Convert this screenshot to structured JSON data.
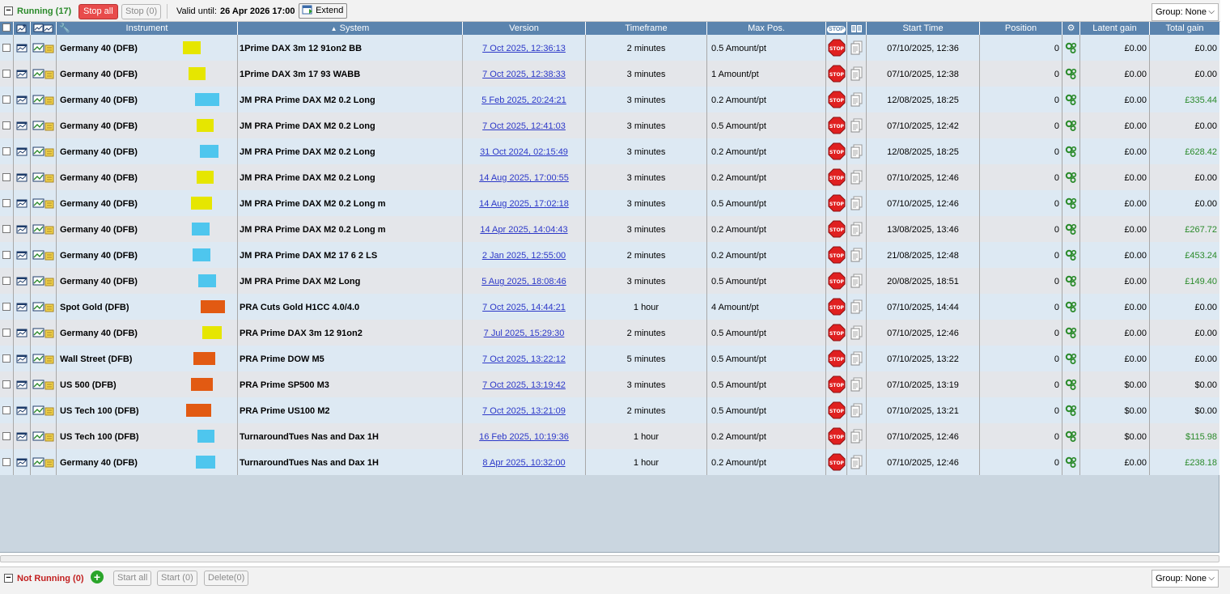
{
  "running": {
    "title": "Running (17)",
    "stop_all": "Stop all",
    "stop_btn": "Stop (0)",
    "valid_until_label": "Valid until:",
    "valid_until": "26 Apr 2026 17:00",
    "extend": "Extend",
    "group": "Group: None"
  },
  "columns": {
    "instrument": "Instrument",
    "system": "System",
    "version": "Version",
    "timeframe": "Timeframe",
    "max_pos": "Max Pos.",
    "stop_badge": "STOP",
    "start_time": "Start Time",
    "position": "Position",
    "latent_gain": "Latent gain",
    "total_gain": "Total gain"
  },
  "colors": {
    "yellow": "#e6e600",
    "cyan": "#4ec6ee",
    "orange": "#e25a12",
    "header": "#5b84ae",
    "gain_positive": "#2a8a2a",
    "link": "#2c38c8"
  },
  "rows": [
    {
      "instrument": "Germany 40 (DFB)",
      "tag": "yellow",
      "system": "1Prime DAX 3m 12 91on2 BB",
      "version": "7 Oct 2025, 12:36:13",
      "timeframe": "2 minutes",
      "maxpos": "0.5 Amount/pt",
      "start": "07/10/2025, 12:36",
      "position": "0",
      "latent": "£0.00",
      "total": "£0.00",
      "pos": false
    },
    {
      "instrument": "Germany 40 (DFB)",
      "tag": "yellow",
      "system": "1Prime DAX 3m 17 93 WABB",
      "version": "7 Oct 2025, 12:38:33",
      "timeframe": "3 minutes",
      "maxpos": "1 Amount/pt",
      "start": "07/10/2025, 12:38",
      "position": "0",
      "latent": "£0.00",
      "total": "£0.00",
      "pos": false
    },
    {
      "instrument": "Germany 40 (DFB)",
      "tag": "cyan",
      "system": "JM PRA Prime DAX M2 0.2 Long",
      "version": "5 Feb 2025, 20:24:21",
      "timeframe": "3 minutes",
      "maxpos": "0.2 Amount/pt",
      "start": "12/08/2025, 18:25",
      "position": "0",
      "latent": "£0.00",
      "total": "£335.44",
      "pos": true
    },
    {
      "instrument": "Germany 40 (DFB)",
      "tag": "yellow",
      "system": "JM PRA Prime DAX M2 0.2 Long",
      "version": "7 Oct 2025, 12:41:03",
      "timeframe": "3 minutes",
      "maxpos": "0.5 Amount/pt",
      "start": "07/10/2025, 12:42",
      "position": "0",
      "latent": "£0.00",
      "total": "£0.00",
      "pos": false
    },
    {
      "instrument": "Germany 40 (DFB)",
      "tag": "cyan",
      "system": "JM PRA Prime DAX M2 0.2 Long",
      "version": "31 Oct 2024, 02:15:49",
      "timeframe": "3 minutes",
      "maxpos": "0.2 Amount/pt",
      "start": "12/08/2025, 18:25",
      "position": "0",
      "latent": "£0.00",
      "total": "£628.42",
      "pos": true
    },
    {
      "instrument": "Germany 40 (DFB)",
      "tag": "yellow",
      "system": "JM PRA Prime DAX M2 0.2 Long",
      "version": "14 Aug 2025, 17:00:55",
      "timeframe": "3 minutes",
      "maxpos": "0.2 Amount/pt",
      "start": "07/10/2025, 12:46",
      "position": "0",
      "latent": "£0.00",
      "total": "£0.00",
      "pos": false
    },
    {
      "instrument": "Germany 40 (DFB)",
      "tag": "yellow",
      "system": "JM PRA Prime DAX M2 0.2 Long m",
      "version": "14 Aug 2025, 17:02:18",
      "timeframe": "3 minutes",
      "maxpos": "0.5 Amount/pt",
      "start": "07/10/2025, 12:46",
      "position": "0",
      "latent": "£0.00",
      "total": "£0.00",
      "pos": false
    },
    {
      "instrument": "Germany 40 (DFB)",
      "tag": "cyan",
      "system": "JM PRA Prime DAX M2 0.2 Long m",
      "version": "14 Apr 2025, 14:04:43",
      "timeframe": "3 minutes",
      "maxpos": "0.2 Amount/pt",
      "start": "13/08/2025, 13:46",
      "position": "0",
      "latent": "£0.00",
      "total": "£267.72",
      "pos": true
    },
    {
      "instrument": "Germany 40 (DFB)",
      "tag": "cyan",
      "system": "JM PRA Prime DAX M2 17 6 2 LS",
      "version": "2 Jan 2025, 12:55:00",
      "timeframe": "2 minutes",
      "maxpos": "0.2 Amount/pt",
      "start": "21/08/2025, 12:48",
      "position": "0",
      "latent": "£0.00",
      "total": "£453.24",
      "pos": true
    },
    {
      "instrument": "Germany 40 (DFB)",
      "tag": "cyan",
      "system": "JM PRA Prime DAX M2 Long",
      "version": "5 Aug 2025, 18:08:46",
      "timeframe": "3 minutes",
      "maxpos": "0.5 Amount/pt",
      "start": "20/08/2025, 18:51",
      "position": "0",
      "latent": "£0.00",
      "total": "£149.40",
      "pos": true
    },
    {
      "instrument": "Spot Gold (DFB)",
      "tag": "orange",
      "system": "PRA Cuts Gold H1CC 4.0/4.0",
      "version": "7 Oct 2025, 14:44:21",
      "timeframe": "1 hour",
      "maxpos": "4 Amount/pt",
      "start": "07/10/2025, 14:44",
      "position": "0",
      "latent": "£0.00",
      "total": "£0.00",
      "pos": false
    },
    {
      "instrument": "Germany 40 (DFB)",
      "tag": "yellow",
      "system": "PRA Prime DAX 3m 12 91on2",
      "version": "7 Jul 2025, 15:29:30",
      "timeframe": "2 minutes",
      "maxpos": "0.5 Amount/pt",
      "start": "07/10/2025, 12:46",
      "position": "0",
      "latent": "£0.00",
      "total": "£0.00",
      "pos": false
    },
    {
      "instrument": "Wall Street (DFB)",
      "tag": "orange",
      "system": "PRA Prime DOW M5",
      "version": "7 Oct 2025, 13:22:12",
      "timeframe": "5 minutes",
      "maxpos": "0.5 Amount/pt",
      "start": "07/10/2025, 13:22",
      "position": "0",
      "latent": "£0.00",
      "total": "£0.00",
      "pos": false
    },
    {
      "instrument": "US 500 (DFB)",
      "tag": "orange",
      "system": "PRA Prime SP500 M3",
      "version": "7 Oct 2025, 13:19:42",
      "timeframe": "3 minutes",
      "maxpos": "0.5 Amount/pt",
      "start": "07/10/2025, 13:19",
      "position": "0",
      "latent": "$0.00",
      "total": "$0.00",
      "pos": false
    },
    {
      "instrument": "US Tech 100 (DFB)",
      "tag": "orange",
      "system": "PRA Prime US100 M2",
      "version": "7 Oct 2025, 13:21:09",
      "timeframe": "2 minutes",
      "maxpos": "0.5 Amount/pt",
      "start": "07/10/2025, 13:21",
      "position": "0",
      "latent": "$0.00",
      "total": "$0.00",
      "pos": false
    },
    {
      "instrument": "US Tech 100 (DFB)",
      "tag": "cyan",
      "system": "TurnaroundTues Nas and Dax 1H",
      "version": "16 Feb 2025, 10:19:36",
      "timeframe": "1 hour",
      "maxpos": "0.2 Amount/pt",
      "start": "07/10/2025, 12:46",
      "position": "0",
      "latent": "$0.00",
      "total": "$115.98",
      "pos": true
    },
    {
      "instrument": "Germany 40 (DFB)",
      "tag": "cyan",
      "system": "TurnaroundTues Nas and Dax 1H",
      "version": "8 Apr 2025, 10:32:00",
      "timeframe": "1 hour",
      "maxpos": "0.2 Amount/pt",
      "start": "07/10/2025, 12:46",
      "position": "0",
      "latent": "£0.00",
      "total": "£238.18",
      "pos": true
    }
  ],
  "not_running": {
    "title": "Not Running (0)",
    "start_all": "Start all",
    "start_btn": "Start (0)",
    "delete_btn": "Delete(0)",
    "group": "Group: None"
  }
}
